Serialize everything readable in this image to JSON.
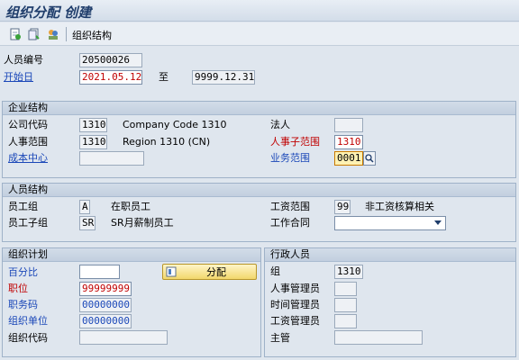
{
  "window": {
    "title": "组织分配 创建"
  },
  "toolbar": {
    "org_structure_label": "组织结构"
  },
  "header": {
    "person_number_label": "人员编号",
    "person_number": "20500026",
    "start_label": "开始日",
    "start_date": "2021.05.12",
    "to_label": "至",
    "end_date": "9999.12.31"
  },
  "enterprise": {
    "title": "企业结构",
    "company_code_label": "公司代码",
    "company_code": "1310",
    "company_code_text": "Company Code 1310",
    "legal_person_label": "法人",
    "legal_person": "",
    "personnel_area_label": "人事范围",
    "personnel_area": "1310",
    "personnel_area_text": "Region 1310 (CN)",
    "subarea_label": "人事子范围",
    "subarea": "1310",
    "cost_center_label": "成本中心",
    "cost_center": "",
    "business_area_label": "业务范围",
    "business_area": "0001"
  },
  "personnel": {
    "title": "人员结构",
    "group_label": "员工组",
    "group": "A",
    "group_text": "在职员工",
    "subgroup_label": "员工子组",
    "subgroup": "SR",
    "subgroup_text": "SR月薪制员工",
    "payroll_area_label": "工资范围",
    "payroll_area": "99",
    "payroll_area_text": "非工资核算相关",
    "contract_label": "工作合同",
    "contract": ""
  },
  "org_plan": {
    "title": "组织计划",
    "percent_label": "百分比",
    "percent": "",
    "assign_button": "分配",
    "position_label": "职位",
    "position": "99999999",
    "job_label": "职务码",
    "job": "00000000",
    "org_unit_label": "组织单位",
    "org_unit": "00000000",
    "org_code_label": "组织代码",
    "org_code": ""
  },
  "admin": {
    "title": "行政人员",
    "group_label": "组",
    "group": "1310",
    "hr_admin_label": "人事管理员",
    "hr_admin": "",
    "time_admin_label": "时间管理员",
    "time_admin": "",
    "payroll_admin_label": "工资管理员",
    "payroll_admin": "",
    "supervisor_label": "主管",
    "supervisor": ""
  },
  "colors": {
    "accent_red": "#c00000",
    "link_blue": "#1a47b8",
    "focus_yellow": "#fff2b3"
  }
}
